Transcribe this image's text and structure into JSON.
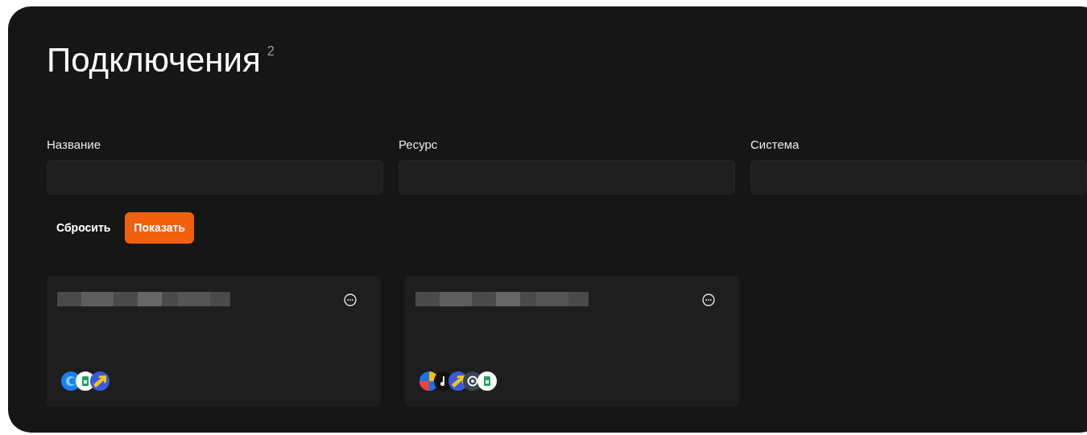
{
  "title": "Подключения",
  "count": "2",
  "filters": [
    {
      "label": "Название"
    },
    {
      "label": "Ресурс"
    },
    {
      "label": "Система"
    }
  ],
  "buttons": [
    {
      "label": "Сбросить",
      "kind": "plain"
    },
    {
      "label": "Показать",
      "kind": "primary"
    }
  ],
  "cards": [
    {
      "icons": [
        {
          "kind": "blue-ring"
        },
        {
          "kind": "sheet"
        },
        {
          "kind": "yellow-arrow"
        }
      ]
    },
    {
      "icons": [
        {
          "kind": "multicolor"
        },
        {
          "kind": "note"
        },
        {
          "kind": "yellow-arrow"
        },
        {
          "kind": "loop"
        },
        {
          "kind": "sheet"
        }
      ]
    }
  ]
}
